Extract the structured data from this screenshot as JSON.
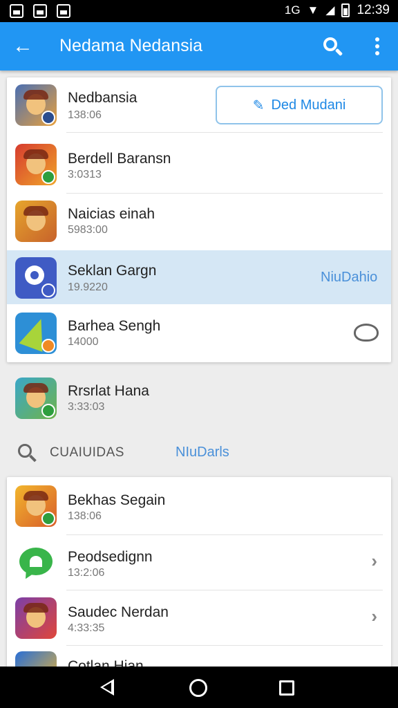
{
  "status_bar": {
    "time": "12:39",
    "indicators": "1G"
  },
  "app_bar": {
    "title": "Nedama Nedansia",
    "back_icon": "arrow-left-icon",
    "search_icon": "search-icon",
    "menu_icon": "more-vert-icon"
  },
  "colors": {
    "accent": "#2196f3",
    "link": "#4a90d9",
    "highlight": "#d5e7f5"
  },
  "card1": {
    "items": [
      {
        "title": "Nedbansia",
        "subtitle": "138:06",
        "action_label": "Ded Mudani"
      },
      {
        "title": "Berdell Baransn",
        "subtitle": "3:0313"
      },
      {
        "title": "Naicias einah",
        "subtitle": "5983:00"
      },
      {
        "title": "Seklan Gargn",
        "subtitle": "19.9220",
        "action_label": "NiuDahio"
      },
      {
        "title": "Barhea Sengh",
        "subtitle": "14000"
      }
    ]
  },
  "free_item": {
    "title": "Rrsrlat Hana",
    "subtitle": "3:33:03"
  },
  "section": {
    "label": "CUAIUIDAS",
    "link": "NIuDarls"
  },
  "card2": {
    "items": [
      {
        "title": "Bekhas Segain",
        "subtitle": "138:06"
      },
      {
        "title": "Peodsedignn",
        "subtitle": "13:2:06"
      },
      {
        "title": "Saudec Nerdan",
        "subtitle": "4:33:35"
      },
      {
        "title": "Cotlan Hian",
        "subtitle": ""
      }
    ]
  },
  "nav": {
    "back_icon": "nav-back-icon",
    "home_icon": "nav-home-icon",
    "recents_icon": "nav-recents-icon"
  }
}
